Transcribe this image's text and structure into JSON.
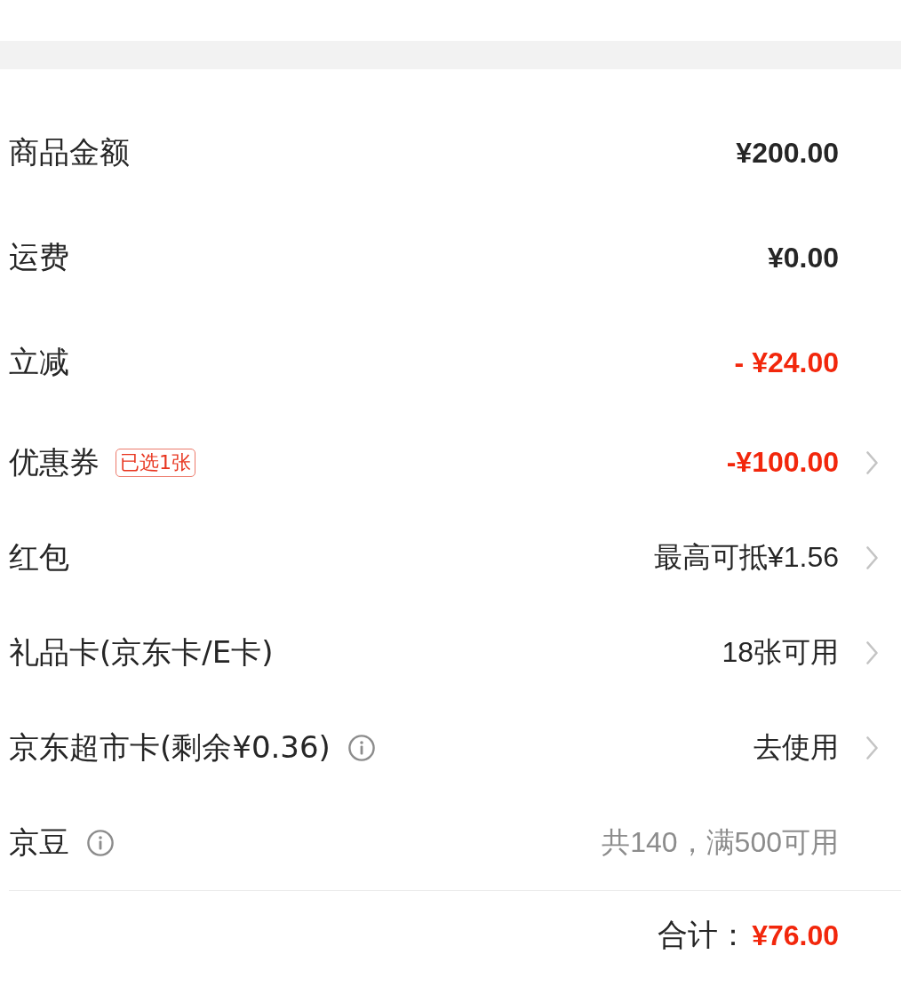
{
  "price_summary": {
    "rows": [
      {
        "label": "商品金额",
        "info": false,
        "value": "¥200.00",
        "kind": "amount",
        "chevron": false
      },
      {
        "label": "运费",
        "info": false,
        "value": "¥0.00",
        "kind": "amount",
        "chevron": false
      },
      {
        "label": "立减",
        "info": false,
        "value": "- ¥24.00",
        "kind": "deduction",
        "chevron": false
      },
      {
        "label": "优惠券",
        "badge": "已选1张",
        "info": false,
        "value": "-¥100.00",
        "kind": "deduction",
        "chevron": true
      },
      {
        "label": "红包",
        "info": false,
        "value": "最高可抵¥1.56",
        "kind": "action",
        "chevron": true
      },
      {
        "label": "礼品卡(京东卡/E卡)",
        "info": false,
        "value": "18张可用",
        "kind": "action",
        "chevron": true
      },
      {
        "label": "京东超市卡(剩余¥0.36)",
        "info": true,
        "value": "去使用",
        "kind": "action",
        "chevron": true
      },
      {
        "label": "京豆",
        "info": true,
        "value": "共140，满500可用",
        "kind": "muted",
        "chevron": false
      }
    ]
  },
  "total": {
    "label": "合计：",
    "amount": "¥76.00"
  }
}
